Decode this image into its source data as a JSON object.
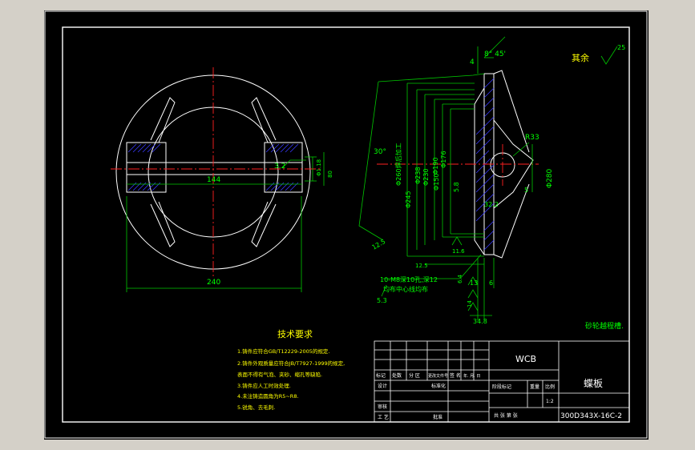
{
  "colors": {
    "outer_bg": "#d4d0c8",
    "canvas": "#000000",
    "line": "#ffffff",
    "dim": "#00c800",
    "center": "#ff2020",
    "hatch": "#3030ff",
    "text_green": "#00ff00",
    "text_yellow": "#ffff00",
    "title_white": "#ffffff"
  },
  "plan_view": {
    "dim_width": "144",
    "dim_diameter": "240",
    "dim_slot": "3.2",
    "dim_hole": "Φ1.18",
    "dim_side": "80"
  },
  "section_view": {
    "angle_top": "8° 45'",
    "angle_side": "30°",
    "dim_4": "4",
    "dim_r33": "R33",
    "dim_phi280": "Φ280",
    "dim_phi245": "Φ245",
    "dim_phi238": "Φ238",
    "dim_phi230": "Φ230",
    "dim_phi190": "Φ190",
    "dim_phi176": "Φ176",
    "dim_phi150": "Φ150",
    "dim_58": "5.8",
    "dim_5": "5",
    "dim_322": "32.2",
    "dim_116": "11.6",
    "dim_125": "12.5",
    "dim_125b": "12.5",
    "dim_13": "13",
    "dim_6": "6",
    "dim_53": "5.3",
    "dim_348": "34.8",
    "dim_64": "6.4",
    "dim_14": "14",
    "hole_note_1": "10-M8深10孔,深12",
    "hole_note_2": "均布中心线均布",
    "vert_note": "Φ260焊后加工",
    "roughness_rest": "其余",
    "roughness_value": "25",
    "break_note": "砂轮越程槽."
  },
  "tech_requirements": {
    "heading": "技术要求",
    "items": [
      "1.铸件应符合GB/T12229-2005的规定.",
      "2.铸件外观质量应符合JB/T7927-1999的规定,",
      "  表面不得有气泡、夹砂、缩孔等缺陷.",
      "3.铸件应人工时效处理.",
      "4.未注铸造圆角为R5~R8.",
      "5.锐角、去毛刺."
    ]
  },
  "title_block": {
    "material": "WCB",
    "part_name": "蝶板",
    "drawing_no": "300D343X-16C-2",
    "scale": "1:2",
    "hdr_mark": "标记",
    "hdr_count": "处数",
    "hdr_zone": "分 区",
    "hdr_docno": "更改文件号",
    "hdr_sign": "签 名",
    "hdr_date": "年. 月. 日",
    "row_design": "设计",
    "row_standard": "标准化",
    "row_stage": "阶段标记",
    "row_weight": "重量",
    "row_ratio": "比例",
    "row_audit": "审核",
    "row_process": "工 艺",
    "row_approve": "批准",
    "row_sheets": "共  张  第  张"
  }
}
